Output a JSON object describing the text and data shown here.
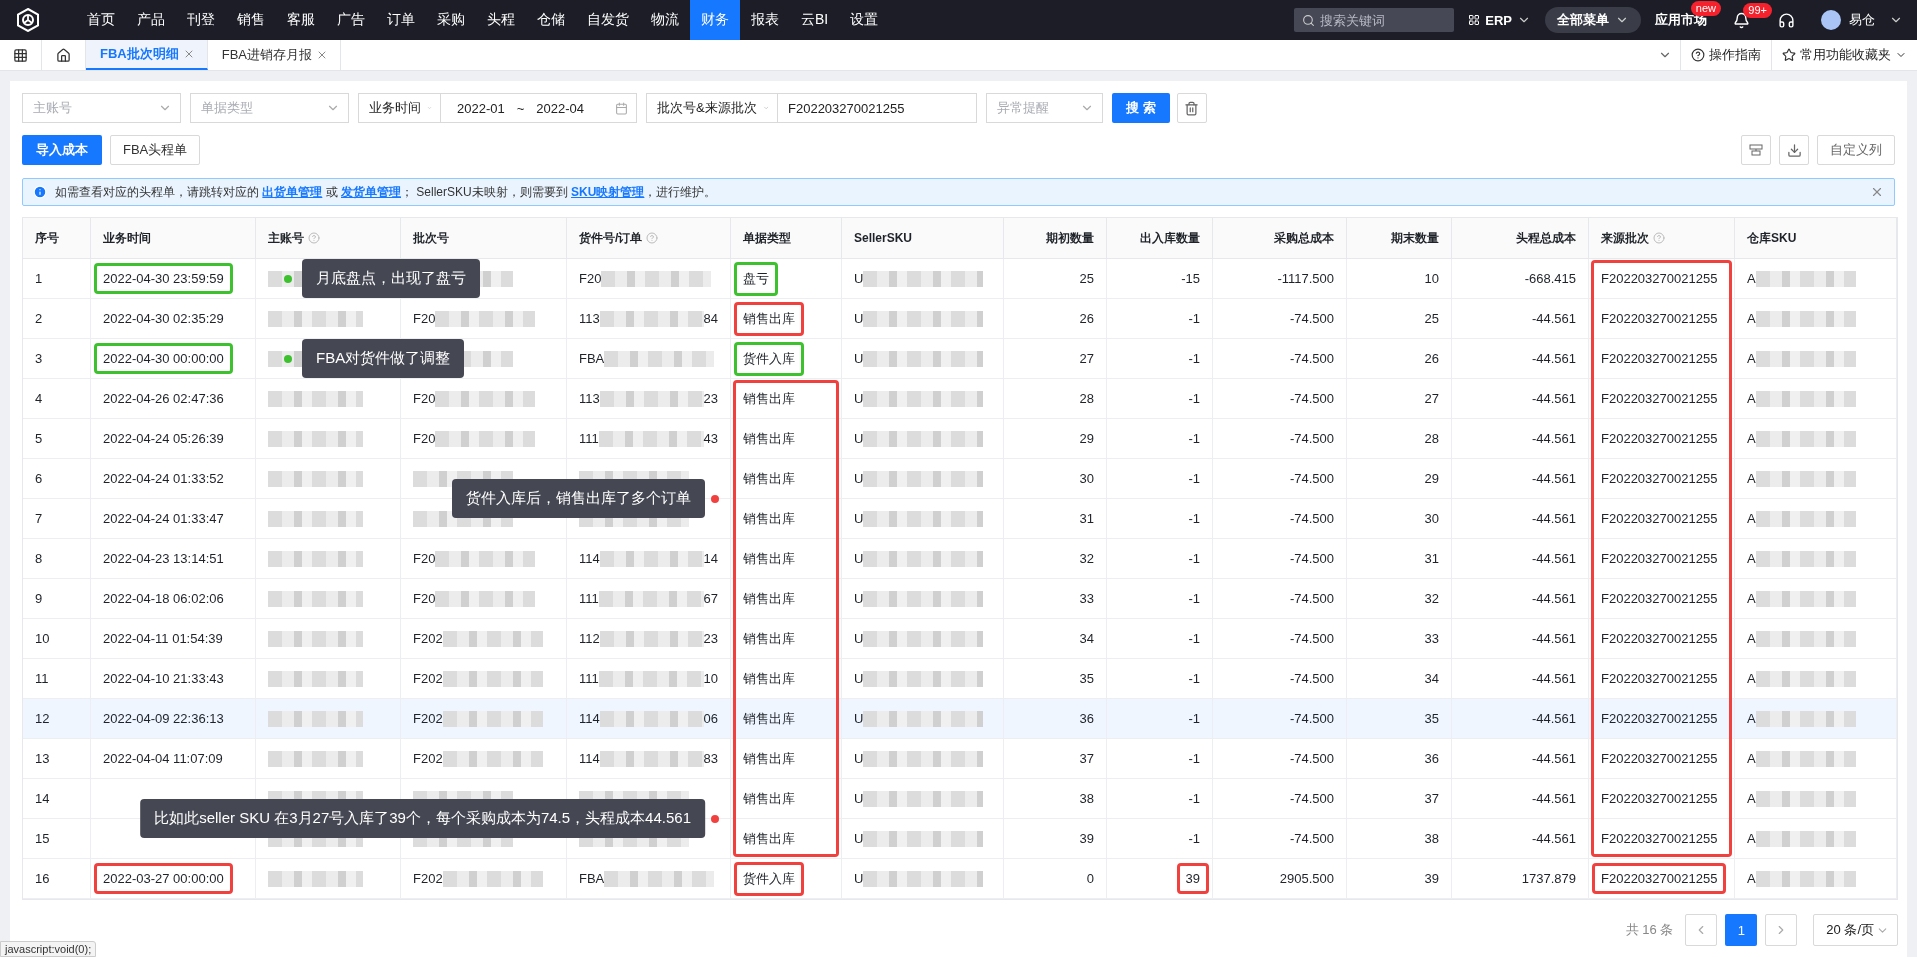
{
  "nav": {
    "items": [
      {
        "label": "首页",
        "selected": false
      },
      {
        "label": "产品",
        "selected": false
      },
      {
        "label": "刊登",
        "selected": false
      },
      {
        "label": "销售",
        "selected": false
      },
      {
        "label": "客服",
        "selected": false
      },
      {
        "label": "广告",
        "selected": false
      },
      {
        "label": "订单",
        "selected": false
      },
      {
        "label": "采购",
        "selected": false
      },
      {
        "label": "头程",
        "selected": false
      },
      {
        "label": "仓储",
        "selected": false
      },
      {
        "label": "自发货",
        "selected": false
      },
      {
        "label": "物流",
        "selected": false
      },
      {
        "label": "财务",
        "selected": true
      },
      {
        "label": "报表",
        "selected": false
      },
      {
        "label": "云BI",
        "selected": false
      },
      {
        "label": "设置",
        "selected": false
      }
    ],
    "search": {
      "placeholder": "搜索关键词"
    },
    "system": "ERP",
    "all_menu": "全部菜单",
    "app_market": {
      "label": "应用市场",
      "badge": "new"
    },
    "notifications": {
      "badge": "99+"
    },
    "user": "易仓"
  },
  "tabs": [
    {
      "label": "FBA批次明细",
      "selected": true
    },
    {
      "label": "FBA进销存月报",
      "selected": false
    }
  ],
  "tab_links": [
    "操作指南",
    "常用功能收藏夹"
  ],
  "filters": [
    {
      "kind": "select",
      "placeholder": "主账号"
    },
    {
      "kind": "select",
      "placeholder": "单据类型"
    },
    {
      "kind": "addon-select",
      "value": "业务时间"
    },
    {
      "kind": "date-range",
      "start": "2022-01",
      "separator": "~",
      "end": "2022-04"
    },
    {
      "kind": "addon-select",
      "value": "批次号&来源批次"
    },
    {
      "kind": "input",
      "value": "F202203270021255"
    },
    {
      "kind": "select-small",
      "placeholder": "异常提醒"
    }
  ],
  "search_button": "搜 索",
  "actions": [
    {
      "label": "导入成本",
      "kind": "primary"
    },
    {
      "label": "FBA头程单",
      "kind": "default"
    }
  ],
  "customize_columns": "自定义列",
  "alert": [
    {
      "text": "如需查看对应的头程单，请跳转对应的 ",
      "link": false
    },
    {
      "text": "出货单管理",
      "link": true
    },
    {
      "text": " 或 ",
      "link": false
    },
    {
      "text": "发货单管理",
      "link": true
    },
    {
      "text": "；  SellerSKU未映射，则需要到 ",
      "link": false
    },
    {
      "text": "SKU映射管理",
      "link": true
    },
    {
      "text": "，进行维护。",
      "link": false
    }
  ],
  "table": {
    "columns": [
      {
        "label": "序号",
        "help": false,
        "kind": "text"
      },
      {
        "label": "业务时间",
        "help": false,
        "kind": "text"
      },
      {
        "label": "主账号",
        "help": true,
        "kind": "blurred"
      },
      {
        "label": "批次号",
        "help": false,
        "kind": "blurred"
      },
      {
        "label": "货件号/订单",
        "help": true,
        "kind": "blurred"
      },
      {
        "label": "单据类型",
        "help": false,
        "kind": "text"
      },
      {
        "label": "SellerSKU",
        "help": false,
        "kind": "blurred"
      },
      {
        "label": "期初数量",
        "help": false,
        "kind": "number"
      },
      {
        "label": "出入库数量",
        "help": false,
        "kind": "number"
      },
      {
        "label": "采购总成本",
        "help": false,
        "kind": "number"
      },
      {
        "label": "期末数量",
        "help": false,
        "kind": "number"
      },
      {
        "label": "头程总成本",
        "help": false,
        "kind": "number"
      },
      {
        "label": "来源批次",
        "help": true,
        "kind": "text"
      },
      {
        "label": "仓库SKU",
        "help": false,
        "kind": "blurred"
      }
    ],
    "rows": [
      {
        "highlighted": false,
        "callout": {
          "kind": "dot-before",
          "text": "月底盘点，出现了盘亏",
          "color": "#3ec12f"
        },
        "cells": [
          "1",
          {
            "kind": "boxed",
            "text": "2022-04-30 23:59:59",
            "color": "#3ec12f"
          },
          {
            "redacted": true
          },
          {
            "redacted": true
          },
          {
            "redacted": true,
            "start": "F20"
          },
          {
            "kind": "boxed",
            "text": "盘亏",
            "color": "#3ec12f"
          },
          {
            "redacted": true,
            "start": "U"
          },
          "25",
          "-15",
          "-1117.500",
          "10",
          "-668.415",
          {
            "kind": "run-boxed",
            "text": "F202203270021255",
            "color": "#f0413e"
          },
          {
            "redacted": true,
            "start": "A"
          }
        ]
      },
      {
        "highlighted": false,
        "cells": [
          "2",
          "2022-04-30 02:35:29",
          {
            "redacted": true
          },
          {
            "redacted": true,
            "start": "F20"
          },
          {
            "redacted": true,
            "start": "113",
            "end": "84"
          },
          {
            "kind": "boxed",
            "text": "销售出库",
            "color": "#f0413e"
          },
          {
            "redacted": true,
            "start": "U"
          },
          "26",
          "-1",
          "-74.500",
          "25",
          "-44.561",
          {
            "kind": "run-boxed",
            "text": "F202203270021255",
            "color": "#f0413e"
          },
          {
            "redacted": true,
            "start": "A"
          }
        ]
      },
      {
        "highlighted": false,
        "callout": {
          "kind": "dot-before",
          "text": "FBA对货件做了调整",
          "color": "#3ec12f"
        },
        "cells": [
          "3",
          {
            "kind": "boxed",
            "text": "2022-04-30 00:00:00",
            "color": "#3ec12f"
          },
          {
            "redacted": true
          },
          {
            "redacted": true
          },
          {
            "redacted": true,
            "start": "FBA"
          },
          {
            "kind": "boxed",
            "text": "货件入库",
            "color": "#3ec12f"
          },
          {
            "redacted": true,
            "start": "U"
          },
          "27",
          "-1",
          "-74.500",
          "26",
          "-44.561",
          {
            "kind": "run-boxed",
            "text": "F202203270021255",
            "color": "#f0413e"
          },
          {
            "redacted": true,
            "start": "A"
          }
        ]
      },
      {
        "highlighted": false,
        "cells": [
          "4",
          "2022-04-26 02:47:36",
          {
            "redacted": true
          },
          {
            "redacted": true,
            "start": "F20"
          },
          {
            "redacted": true,
            "start": "113",
            "end": "23"
          },
          {
            "kind": "run-boxed",
            "text": "销售出库",
            "color": "#f0413e"
          },
          {
            "redacted": true,
            "start": "U"
          },
          "28",
          "-1",
          "-74.500",
          "27",
          "-44.561",
          {
            "kind": "run-boxed",
            "text": "F202203270021255",
            "color": "#f0413e"
          },
          {
            "redacted": true,
            "start": "A"
          }
        ]
      },
      {
        "highlighted": false,
        "cells": [
          "5",
          "2022-04-24 05:26:39",
          {
            "redacted": true
          },
          {
            "redacted": true,
            "start": "F20"
          },
          {
            "redacted": true,
            "start": "111",
            "end": "43"
          },
          {
            "kind": "run-boxed",
            "text": "销售出库",
            "color": "#f0413e"
          },
          {
            "redacted": true,
            "start": "U"
          },
          "29",
          "-1",
          "-74.500",
          "28",
          "-44.561",
          {
            "kind": "run-boxed",
            "text": "F202203270021255",
            "color": "#f0413e"
          },
          {
            "redacted": true,
            "start": "A"
          }
        ]
      },
      {
        "highlighted": false,
        "callout": {
          "kind": "dot-after",
          "text": "货件入库后，销售出库了多个订单",
          "color": "#f0413e"
        },
        "cells": [
          "6",
          "2022-04-24 01:33:52",
          {
            "redacted": true
          },
          {
            "redacted": true
          },
          {
            "redacted": true
          },
          {
            "kind": "run-boxed",
            "text": "销售出库",
            "color": "#f0413e"
          },
          {
            "redacted": true,
            "start": "U"
          },
          "30",
          "-1",
          "-74.500",
          "29",
          "-44.561",
          {
            "kind": "run-boxed",
            "text": "F202203270021255",
            "color": "#f0413e"
          },
          {
            "redacted": true,
            "start": "A"
          }
        ]
      },
      {
        "highlighted": false,
        "cells": [
          "7",
          "2022-04-24 01:33:47",
          {
            "redacted": true
          },
          {
            "redacted": true
          },
          {
            "redacted": true
          },
          {
            "kind": "run-boxed",
            "text": "销售出库",
            "color": "#f0413e"
          },
          {
            "redacted": true,
            "start": "U"
          },
          "31",
          "-1",
          "-74.500",
          "30",
          "-44.561",
          {
            "kind": "run-boxed",
            "text": "F202203270021255",
            "color": "#f0413e"
          },
          {
            "redacted": true,
            "start": "A"
          }
        ]
      },
      {
        "highlighted": false,
        "cells": [
          "8",
          "2022-04-23 13:14:51",
          {
            "redacted": true
          },
          {
            "redacted": true,
            "start": "F20"
          },
          {
            "redacted": true,
            "start": "114",
            "end": "14"
          },
          {
            "kind": "run-boxed",
            "text": "销售出库",
            "color": "#f0413e"
          },
          {
            "redacted": true,
            "start": "U"
          },
          "32",
          "-1",
          "-74.500",
          "31",
          "-44.561",
          {
            "kind": "run-boxed",
            "text": "F202203270021255",
            "color": "#f0413e"
          },
          {
            "redacted": true,
            "start": "A"
          }
        ]
      },
      {
        "highlighted": false,
        "cells": [
          "9",
          "2022-04-18 06:02:06",
          {
            "redacted": true
          },
          {
            "redacted": true,
            "start": "F20"
          },
          {
            "redacted": true,
            "start": "111",
            "end": "67"
          },
          {
            "kind": "run-boxed",
            "text": "销售出库",
            "color": "#f0413e"
          },
          {
            "redacted": true,
            "start": "U"
          },
          "33",
          "-1",
          "-74.500",
          "32",
          "-44.561",
          {
            "kind": "run-boxed",
            "text": "F202203270021255",
            "color": "#f0413e"
          },
          {
            "redacted": true,
            "start": "A"
          }
        ]
      },
      {
        "highlighted": false,
        "cells": [
          "10",
          "2022-04-11 01:54:39",
          {
            "redacted": true
          },
          {
            "redacted": true,
            "start": "F202"
          },
          {
            "redacted": true,
            "start": "112",
            "end": "23"
          },
          {
            "kind": "run-boxed",
            "text": "销售出库",
            "color": "#f0413e"
          },
          {
            "redacted": true,
            "start": "U"
          },
          "34",
          "-1",
          "-74.500",
          "33",
          "-44.561",
          {
            "kind": "run-boxed",
            "text": "F202203270021255",
            "color": "#f0413e"
          },
          {
            "redacted": true,
            "start": "A"
          }
        ]
      },
      {
        "highlighted": false,
        "cells": [
          "11",
          "2022-04-10 21:33:43",
          {
            "redacted": true
          },
          {
            "redacted": true,
            "start": "F202"
          },
          {
            "redacted": true,
            "start": "111",
            "end": "10"
          },
          {
            "kind": "run-boxed",
            "text": "销售出库",
            "color": "#f0413e"
          },
          {
            "redacted": true,
            "start": "U"
          },
          "35",
          "-1",
          "-74.500",
          "34",
          "-44.561",
          {
            "kind": "run-boxed",
            "text": "F202203270021255",
            "color": "#f0413e"
          },
          {
            "redacted": true,
            "start": "A"
          }
        ]
      },
      {
        "highlighted": true,
        "cells": [
          "12",
          "2022-04-09 22:36:13",
          {
            "redacted": true
          },
          {
            "redacted": true,
            "start": "F202"
          },
          {
            "redacted": true,
            "start": "114",
            "end": "06"
          },
          {
            "kind": "run-boxed",
            "text": "销售出库",
            "color": "#f0413e"
          },
          {
            "redacted": true,
            "start": "U"
          },
          "36",
          "-1",
          "-74.500",
          "35",
          "-44.561",
          {
            "kind": "run-boxed",
            "text": "F202203270021255",
            "color": "#f0413e"
          },
          {
            "redacted": true,
            "start": "A"
          }
        ]
      },
      {
        "highlighted": false,
        "cells": [
          "13",
          "2022-04-04 11:07:09",
          {
            "redacted": true
          },
          {
            "redacted": true,
            "start": "F202"
          },
          {
            "redacted": true,
            "start": "114",
            "end": "83"
          },
          {
            "kind": "run-boxed",
            "text": "销售出库",
            "color": "#f0413e"
          },
          {
            "redacted": true,
            "start": "U"
          },
          "37",
          "-1",
          "-74.500",
          "36",
          "-44.561",
          {
            "kind": "run-boxed",
            "text": "F202203270021255",
            "color": "#f0413e"
          },
          {
            "redacted": true,
            "start": "A"
          }
        ]
      },
      {
        "highlighted": false,
        "callout": {
          "kind": "dot-after",
          "text": "比如此seller SKU 在3月27号入库了39个，每个采购成本为74.5，头程成本44.561",
          "color": "#f0413e"
        },
        "cells": [
          "14",
          null,
          {
            "redacted": true
          },
          {
            "redacted": true
          },
          {
            "redacted": true
          },
          {
            "kind": "run-boxed",
            "text": "销售出库",
            "color": "#f0413e"
          },
          {
            "redacted": true,
            "start": "U"
          },
          "38",
          "-1",
          "-74.500",
          "37",
          "-44.561",
          {
            "kind": "run-boxed",
            "text": "F202203270021255",
            "color": "#f0413e"
          },
          {
            "redacted": true,
            "start": "A"
          }
        ]
      },
      {
        "highlighted": false,
        "cells": [
          "15",
          null,
          {
            "redacted": true
          },
          {
            "redacted": true
          },
          {
            "redacted": true
          },
          {
            "kind": "run-boxed",
            "text": "销售出库",
            "color": "#f0413e"
          },
          {
            "redacted": true,
            "start": "U"
          },
          "39",
          "-1",
          "-74.500",
          "38",
          "-44.561",
          {
            "kind": "run-boxed",
            "text": "F202203270021255",
            "color": "#f0413e"
          },
          {
            "redacted": true,
            "start": "A"
          }
        ]
      },
      {
        "highlighted": false,
        "cells": [
          "16",
          {
            "kind": "boxed",
            "text": "2022-03-27 00:00:00",
            "color": "#f0413e"
          },
          {
            "redacted": true
          },
          {
            "redacted": true,
            "start": "F202"
          },
          {
            "redacted": true,
            "start": "FBA"
          },
          {
            "kind": "boxed",
            "text": "货件入库",
            "color": "#f0413e"
          },
          {
            "redacted": true,
            "start": "U"
          },
          "0",
          {
            "kind": "boxed",
            "text": "39",
            "color": "#f0413e"
          },
          "2905.500",
          "39",
          "1737.879",
          {
            "kind": "boxed",
            "text": "F202203270021255",
            "color": "#f0413e"
          },
          {
            "redacted": true,
            "start": "A"
          }
        ]
      }
    ]
  },
  "pagination": {
    "total": "共 16 条",
    "page": "1",
    "page_size": "20 条/页"
  },
  "status_bar": "javascript:void(0);"
}
